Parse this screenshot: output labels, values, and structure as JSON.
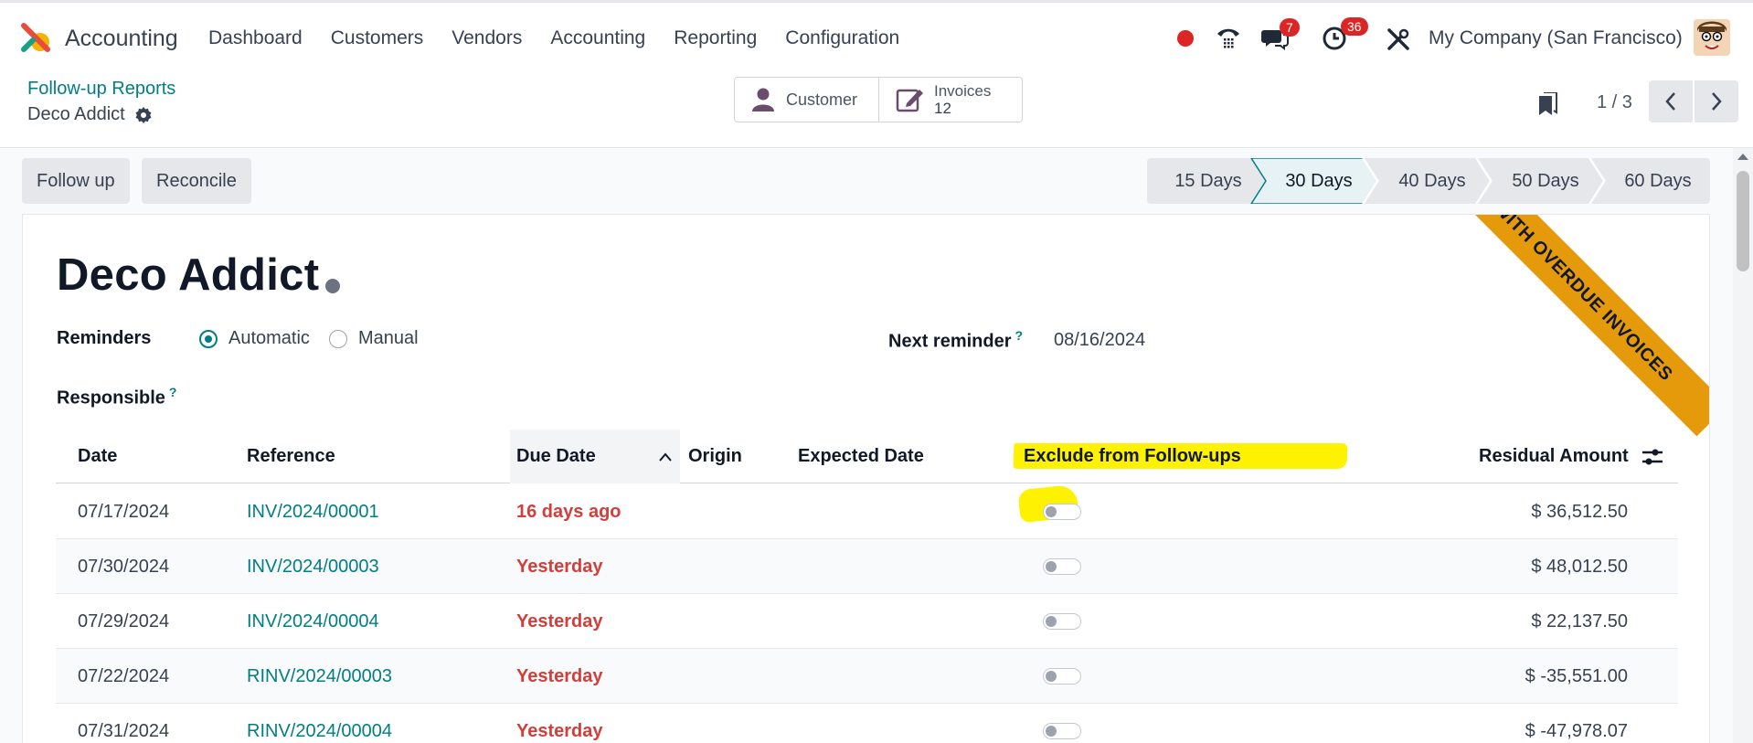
{
  "navbar": {
    "app_name": "Accounting",
    "menu": [
      "Dashboard",
      "Customers",
      "Vendors",
      "Accounting",
      "Reporting",
      "Configuration"
    ],
    "messages_count": "7",
    "activities_count": "36",
    "company": "My Company (San Francisco)"
  },
  "control": {
    "breadcrumb": "Follow-up Reports",
    "record": "Deco Addict",
    "smart_customer": "Customer",
    "smart_invoices_label": "Invoices",
    "smart_invoices_count": "12",
    "pager": "1 / 3"
  },
  "actions": {
    "follow_up": "Follow up",
    "reconcile": "Reconcile"
  },
  "stages": [
    "15 Days",
    "30 Days",
    "40 Days",
    "50 Days",
    "60 Days"
  ],
  "active_stage": "30 Days",
  "sheet": {
    "title": "Deco Addict",
    "ribbon": "WITH OVERDUE INVOICES",
    "reminders_label": "Reminders",
    "reminder_automatic": "Automatic",
    "reminder_manual": "Manual",
    "next_reminder_label": "Next reminder",
    "next_reminder_value": "08/16/2024",
    "responsible_label": "Responsible",
    "help_mark": "?"
  },
  "table": {
    "headers": {
      "date": "Date",
      "reference": "Reference",
      "due_date": "Due Date",
      "origin": "Origin",
      "expected_date": "Expected Date",
      "exclude": "Exclude from Follow-ups",
      "residual": "Residual Amount"
    },
    "rows": [
      {
        "date": "07/17/2024",
        "reference": "INV/2024/00001",
        "due": "16 days ago",
        "amount": "$ 36,512.50"
      },
      {
        "date": "07/30/2024",
        "reference": "INV/2024/00003",
        "due": "Yesterday",
        "amount": "$ 48,012.50"
      },
      {
        "date": "07/29/2024",
        "reference": "INV/2024/00004",
        "due": "Yesterday",
        "amount": "$ 22,137.50"
      },
      {
        "date": "07/22/2024",
        "reference": "RINV/2024/00003",
        "due": "Yesterday",
        "amount": "$ -35,551.00"
      },
      {
        "date": "07/31/2024",
        "reference": "RINV/2024/00004",
        "due": "Yesterday",
        "amount": "$ -47,978.07"
      }
    ]
  },
  "colors": {
    "accent": "#017e84",
    "due": "#d23f3a",
    "ribbon": "#e49a0b",
    "highlight": "#fff200"
  }
}
